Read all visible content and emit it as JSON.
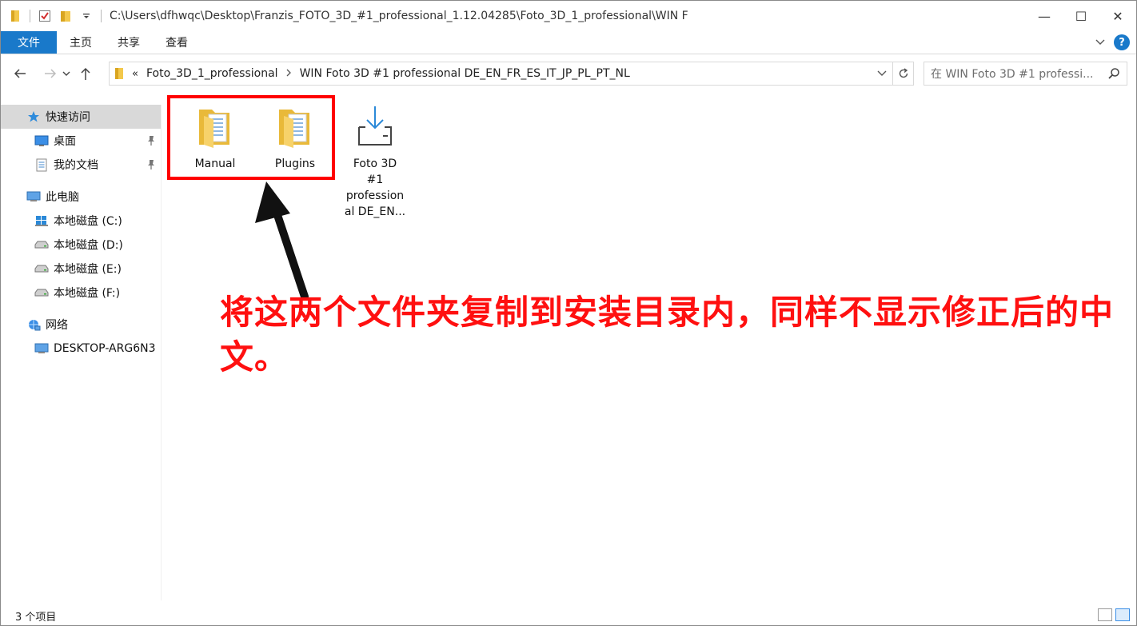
{
  "window": {
    "title_path": "C:\\Users\\dfhwqc\\Desktop\\Franzis_FOTO_3D_#1_professional_1.12.04285\\Foto_3D_1_professional\\WIN F",
    "controls": {
      "minimize": "—",
      "maximize": "☐",
      "close": "✕"
    }
  },
  "ribbon": {
    "tabs": [
      {
        "label": "文件"
      },
      {
        "label": "主页"
      },
      {
        "label": "共享"
      },
      {
        "label": "查看"
      }
    ]
  },
  "address": {
    "overflow": "«",
    "crumbs": [
      "Foto_3D_1_professional",
      "WIN Foto 3D #1 professional DE_EN_FR_ES_IT_JP_PL_PT_NL"
    ],
    "search_placeholder": "在 WIN Foto 3D #1 professi..."
  },
  "sidebar": {
    "items": [
      {
        "label": "快速访问",
        "icon": "star-icon"
      },
      {
        "label": "桌面",
        "icon": "desktop-icon"
      },
      {
        "label": "我的文档",
        "icon": "documents-icon"
      },
      {
        "label": "此电脑",
        "icon": "computer-icon"
      },
      {
        "label": "本地磁盘 (C:)",
        "icon": "windows-drive-icon"
      },
      {
        "label": "本地磁盘 (D:)",
        "icon": "drive-icon"
      },
      {
        "label": "本地磁盘 (E:)",
        "icon": "drive-icon"
      },
      {
        "label": "本地磁盘 (F:)",
        "icon": "drive-icon"
      },
      {
        "label": "网络",
        "icon": "network-icon"
      },
      {
        "label": "DESKTOP-ARG6N3",
        "icon": "computer-icon"
      }
    ]
  },
  "files": [
    {
      "name": "Manual",
      "type": "folder"
    },
    {
      "name": "Plugins",
      "type": "folder"
    },
    {
      "name_lines": [
        "Foto 3D",
        "#1",
        "profession",
        "al DE_EN..."
      ],
      "type": "installer"
    }
  ],
  "annotation": {
    "text": "将这两个文件夹复制到安装目录内，同样不显示修正后的中文。",
    "color": "#ff1010"
  },
  "status": {
    "count": "3 个项目"
  },
  "colors": {
    "accent": "#1979ca",
    "highlight_box": "#ff0000"
  }
}
